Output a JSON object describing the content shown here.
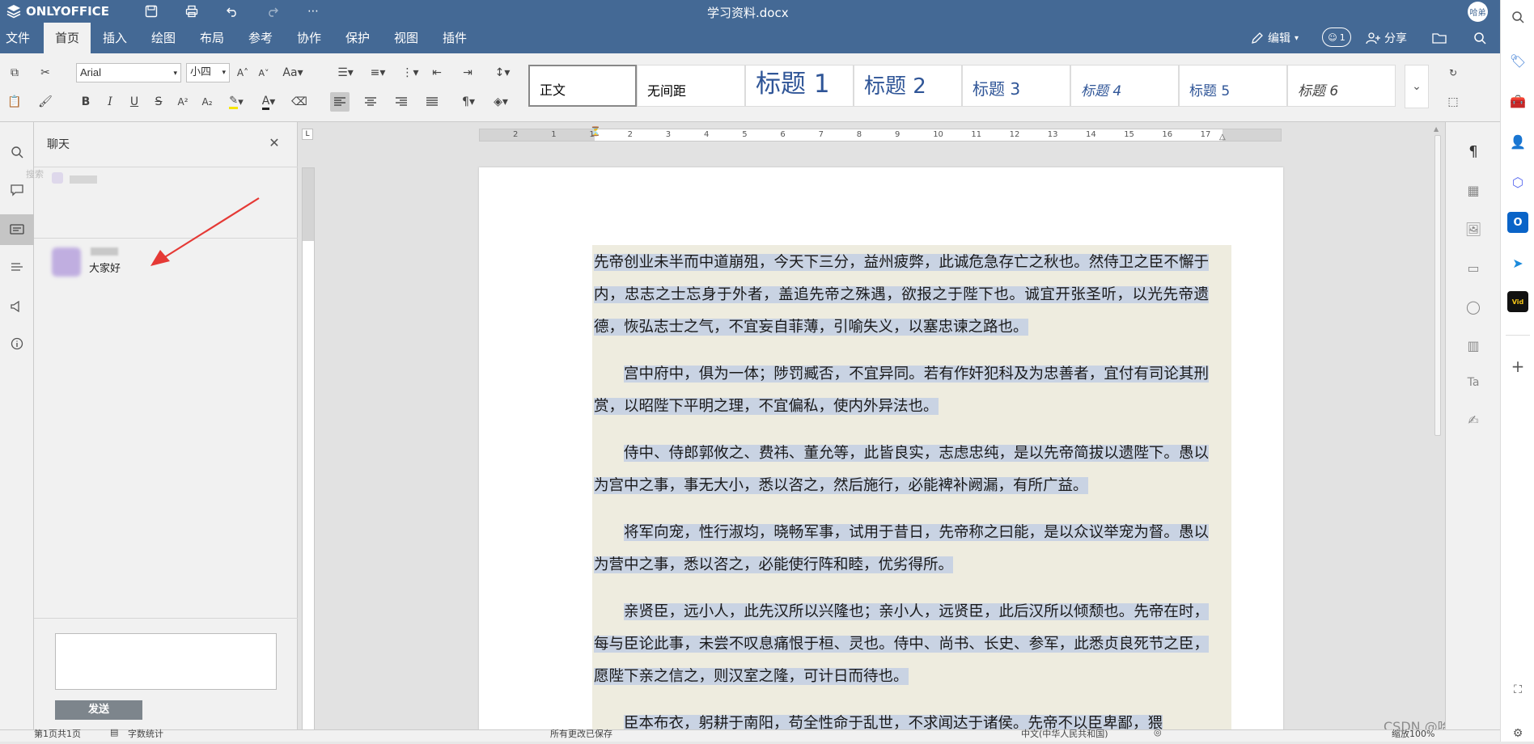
{
  "app": {
    "name": "ONLYOFFICE",
    "doc_title": "学习资料.docx",
    "avatar_text": "哈弟"
  },
  "menu": {
    "tabs": [
      "文件",
      "首页",
      "插入",
      "绘图",
      "布局",
      "参考",
      "协作",
      "保护",
      "视图",
      "插件"
    ],
    "edit_label": "编辑",
    "users_count": "1",
    "share_label": "分享"
  },
  "toolbar": {
    "font_name": "Arial",
    "font_size": "小四",
    "styles": [
      "正文",
      "无间距",
      "标题 1",
      "标题 2",
      "标题 3",
      "标题 4",
      "标题 5",
      "标题 6"
    ],
    "bold": "B",
    "italic": "I",
    "underline": "U",
    "strike": "S"
  },
  "chat": {
    "title": "聊天",
    "search_placeholder": "搜索",
    "message_text": "大家好",
    "send_label": "发送"
  },
  "ruler": {
    "numbers": [
      "2",
      "1",
      "1",
      "2",
      "3",
      "4",
      "5",
      "6",
      "7",
      "8",
      "9",
      "10",
      "11",
      "12",
      "13",
      "14",
      "15",
      "16",
      "17"
    ]
  },
  "document": {
    "paragraphs": [
      "先帝创业未半而中道崩殂，今天下三分，益州疲弊，此诚危急存亡之秋也。然侍卫之臣不懈于内，忠志之士忘身于外者，盖追先帝之殊遇，欲报之于陛下也。诚宜开张圣听，以光先帝遗德，恢弘志士之气，不宜妄自菲薄，引喻失义，以塞忠谏之路也。",
      "宫中府中，俱为一体；陟罚臧否，不宜异同。若有作奸犯科及为忠善者，宜付有司论其刑赏，以昭陛下平明之理，不宜偏私，使内外异法也。",
      "侍中、侍郎郭攸之、费祎、董允等，此皆良实，志虑忠纯，是以先帝简拔以遗陛下。愚以为宫中之事，事无大小，悉以咨之，然后施行，必能裨补阙漏，有所广益。",
      "将军向宠，性行淑均，晓畅军事，试用于昔日，先帝称之曰能，是以众议举宠为督。愚以为营中之事，悉以咨之，必能使行阵和睦，优劣得所。",
      "亲贤臣，远小人，此先汉所以兴隆也；亲小人，远贤臣，此后汉所以倾颓也。先帝在时，每与臣论此事，未尝不叹息痛恨于桓、灵也。侍中、尚书、长史、参军，此悉贞良死节之臣，愿陛下亲之信之，则汉室之隆，可计日而待也。",
      "臣本布衣，躬耕于南阳，苟全性命于乱世，不求闻达于诸侯。先帝不以臣卑鄙，猥"
    ]
  },
  "status": {
    "page": "第1页共1页",
    "word_count": "字数统计",
    "saved": "所有更改已保存",
    "language": "中文(中华人民共和国)",
    "zoom": "缩放100%"
  },
  "watermark": "CSDN @哈弟搬编程",
  "colors": {
    "brand": "#446995",
    "selection": "#c9d3e3",
    "active_tab_bg": "#f1f1f1"
  }
}
